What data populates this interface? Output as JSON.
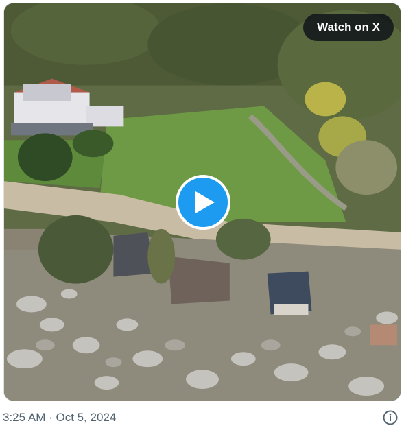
{
  "media": {
    "watch_label": "Watch on X",
    "play_icon": "play-icon",
    "accent_color": "#1d9bf0"
  },
  "footer": {
    "timestamp": "3:25 AM · Oct 5, 2024",
    "info_icon": "info-icon"
  }
}
